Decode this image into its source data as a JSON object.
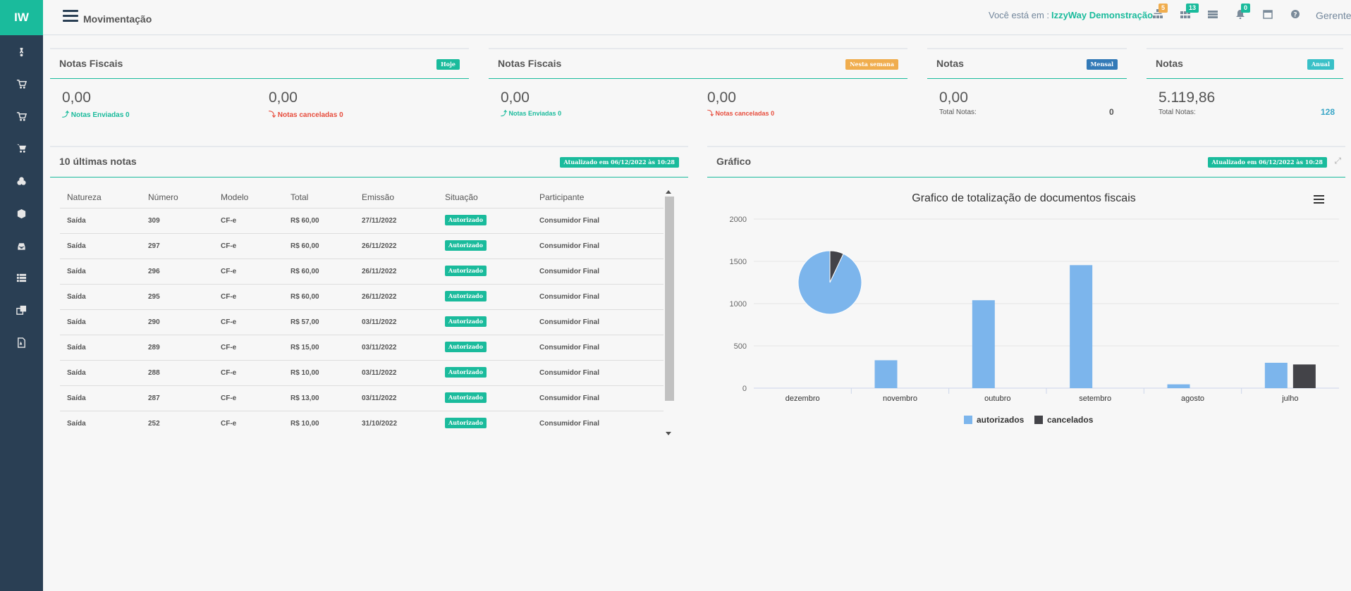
{
  "app": {
    "logo": "IW",
    "page_title": "Movimentação"
  },
  "sidebar": {
    "items": [
      {
        "icon": "bicycle-icon"
      },
      {
        "icon": "cart-icon"
      },
      {
        "icon": "cart-icon"
      },
      {
        "icon": "cart-icon"
      },
      {
        "icon": "cubes-icon"
      },
      {
        "icon": "cube-icon"
      },
      {
        "icon": "inbox-icon"
      },
      {
        "icon": "list-icon"
      },
      {
        "icon": "clone-icon"
      },
      {
        "icon": "file-pdf-icon"
      }
    ]
  },
  "header": {
    "location_prefix": "Você está em :",
    "company": "IzzyWay Demonstração",
    "badges": {
      "sitemap": "5",
      "grid": "13",
      "bell": "0"
    },
    "user": "Gerente"
  },
  "summary": [
    {
      "title": "Notas Fiscais",
      "period": "Hoje",
      "color": "#1abb9c",
      "sent_value": "0,00",
      "sent_label": "Notas Enviadas",
      "sent_count": "0",
      "cancel_value": "0,00",
      "cancel_label": "Notas canceladas",
      "cancel_count": "0"
    },
    {
      "title": "Notas Fiscais",
      "period": "Nesta semana",
      "color": "#f0ad4e",
      "sent_value": "0,00",
      "sent_label": "Notas Enviadas",
      "sent_count": "0",
      "cancel_value": "0,00",
      "cancel_label": "Notas canceladas",
      "cancel_count": "0"
    },
    {
      "title": "Notas",
      "period": "Mensal",
      "color": "#337ab7",
      "value": "0,00",
      "total_label": "Total Notas:",
      "total_count": "0"
    },
    {
      "title": "Notas",
      "period": "Anual",
      "color": "#39c0c7",
      "value": "5.119,86",
      "total_label": "Total Notas:",
      "total_count": "128"
    }
  ],
  "last_notes": {
    "title": "10 últimas notas",
    "updated": "Atualizado em 06/12/2022 às 10:28",
    "columns": [
      "Natureza",
      "Número",
      "Modelo",
      "Total",
      "Emissão",
      "Situação",
      "Participante"
    ],
    "rows": [
      [
        "Saída",
        "309",
        "CF-e",
        "R$ 60,00",
        "27/11/2022",
        "Autorizado",
        "Consumidor Final"
      ],
      [
        "Saída",
        "297",
        "CF-e",
        "R$ 60,00",
        "26/11/2022",
        "Autorizado",
        "Consumidor Final"
      ],
      [
        "Saída",
        "296",
        "CF-e",
        "R$ 60,00",
        "26/11/2022",
        "Autorizado",
        "Consumidor Final"
      ],
      [
        "Saída",
        "295",
        "CF-e",
        "R$ 60,00",
        "26/11/2022",
        "Autorizado",
        "Consumidor Final"
      ],
      [
        "Saída",
        "290",
        "CF-e",
        "R$ 57,00",
        "03/11/2022",
        "Autorizado",
        "Consumidor Final"
      ],
      [
        "Saída",
        "289",
        "CF-e",
        "R$ 15,00",
        "03/11/2022",
        "Autorizado",
        "Consumidor Final"
      ],
      [
        "Saída",
        "288",
        "CF-e",
        "R$ 10,00",
        "03/11/2022",
        "Autorizado",
        "Consumidor Final"
      ],
      [
        "Saída",
        "287",
        "CF-e",
        "R$ 13,00",
        "03/11/2022",
        "Autorizado",
        "Consumidor Final"
      ],
      [
        "Saída",
        "252",
        "CF-e",
        "R$ 10,00",
        "31/10/2022",
        "Autorizado",
        "Consumidor Final"
      ]
    ]
  },
  "chart_panel": {
    "title": "Gráfico",
    "updated": "Atualizado em 06/12/2022 às 10:28"
  },
  "chart_data": {
    "type": "bar",
    "title": "Grafico de totalização de documentos fiscais",
    "categories": [
      "dezembro",
      "novembro",
      "outubro",
      "setembro",
      "agosto",
      "julho"
    ],
    "series": [
      {
        "name": "autorizados",
        "color": "#7cb5ec",
        "values": [
          0,
          330,
          1040,
          1455,
          45,
          300
        ]
      },
      {
        "name": "cancelados",
        "color": "#434348",
        "values": [
          0,
          0,
          0,
          0,
          0,
          280
        ]
      }
    ],
    "ylim": [
      0,
      2000
    ],
    "yticks": [
      0,
      500,
      1000,
      1500,
      2000
    ],
    "grid": true,
    "legend": "bottom",
    "pie": {
      "slices": [
        {
          "name": "autorizados",
          "value": 93
        },
        {
          "name": "cancelados",
          "value": 7
        }
      ]
    }
  }
}
